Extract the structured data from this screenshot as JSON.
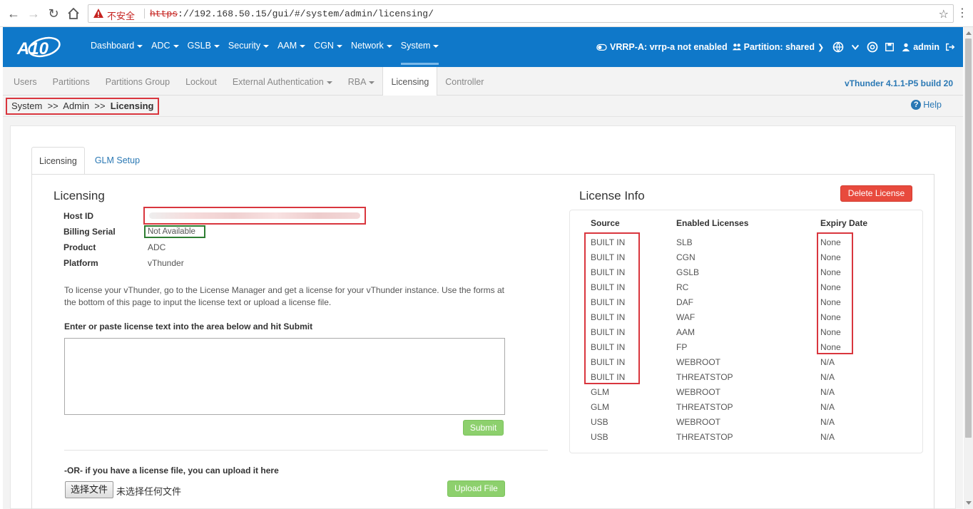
{
  "browser": {
    "insecure_label": "不安全",
    "url_protocol": "https",
    "url_rest": "://192.168.50.15/gui/#/system/admin/licensing/"
  },
  "header": {
    "logo_text": "A10",
    "nav": [
      "Dashboard",
      "ADC",
      "GSLB",
      "Security",
      "AAM",
      "CGN",
      "Network",
      "System"
    ],
    "active_nav": "System",
    "vrrp": "VRRP-A: vrrp-a not enabled",
    "partition": "Partition: shared",
    "user": "admin"
  },
  "subnav": {
    "items": [
      "Users",
      "Partitions",
      "Partitions Group",
      "Lockout",
      "External Authentication",
      "RBA",
      "Licensing",
      "Controller"
    ],
    "version": "vThunder 4.1.1-P5 build 20"
  },
  "breadcrumb": {
    "part1": "System",
    "sep": ">>",
    "part2": "Admin",
    "part3": "Licensing"
  },
  "help": "Help",
  "tabs": [
    "Licensing",
    "GLM Setup"
  ],
  "licensing": {
    "title": "Licensing",
    "host_id_label": "Host ID",
    "billing_label": "Billing Serial",
    "billing_value": "Not Available",
    "product_label": "Product",
    "product_value": "ADC",
    "platform_label": "Platform",
    "platform_value": "vThunder",
    "description": "To license your vThunder, go to the License Manager and get a license for your vThunder instance. Use the forms at the bottom of this page to input the license text or upload a license file.",
    "enter_label": "Enter or paste license text into the area below and hit Submit",
    "submit": "Submit",
    "or_label": "-OR- if you have a license file, you can upload it here",
    "choose_file": "选择文件",
    "no_file": "未选择任何文件",
    "upload": "Upload File"
  },
  "license_info": {
    "title": "License Info",
    "delete": "Delete License",
    "headers": [
      "Source",
      "Enabled Licenses",
      "Expiry Date"
    ],
    "rows": [
      [
        "BUILT IN",
        "SLB",
        "None"
      ],
      [
        "BUILT IN",
        "CGN",
        "None"
      ],
      [
        "BUILT IN",
        "GSLB",
        "None"
      ],
      [
        "BUILT IN",
        "RC",
        "None"
      ],
      [
        "BUILT IN",
        "DAF",
        "None"
      ],
      [
        "BUILT IN",
        "WAF",
        "None"
      ],
      [
        "BUILT IN",
        "AAM",
        "None"
      ],
      [
        "BUILT IN",
        "FP",
        "None"
      ],
      [
        "BUILT IN",
        "WEBROOT",
        "N/A"
      ],
      [
        "BUILT IN",
        "THREATSTOP",
        "N/A"
      ],
      [
        "GLM",
        "WEBROOT",
        "N/A"
      ],
      [
        "GLM",
        "THREATSTOP",
        "N/A"
      ],
      [
        "USB",
        "WEBROOT",
        "N/A"
      ],
      [
        "USB",
        "THREATSTOP",
        "N/A"
      ]
    ]
  }
}
